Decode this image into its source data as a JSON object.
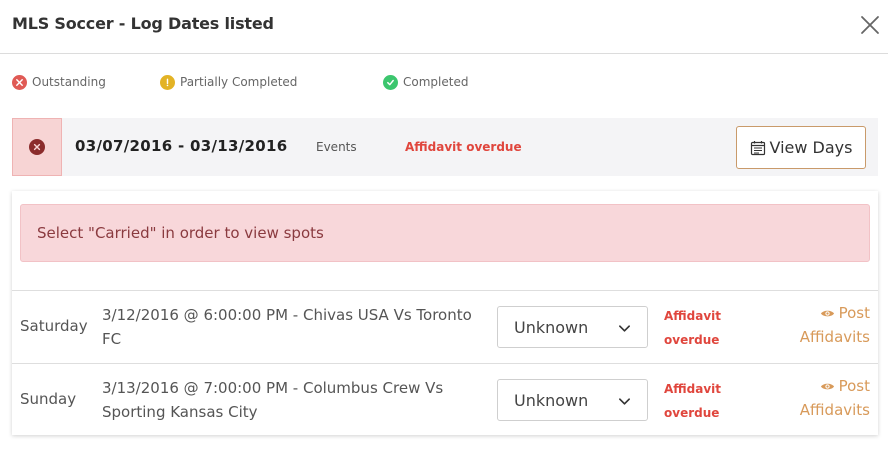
{
  "modal": {
    "title": "MLS Soccer - Log Dates listed"
  },
  "legend": {
    "outstanding": {
      "label": "Outstanding",
      "color": "#e05a55",
      "icon": "x-circle-icon"
    },
    "partial": {
      "label": "Partially Completed",
      "color": "#e3b325",
      "icon": "exclamation-circle-icon"
    },
    "completed": {
      "label": "Completed",
      "color": "#3cc66e",
      "icon": "check-circle-icon"
    }
  },
  "week": {
    "status": "outstanding",
    "range": "03/07/2016 - 03/13/2016",
    "events_label": "Events",
    "overdue_label": "Affidavit overdue",
    "view_days_label": "View Days"
  },
  "alert": {
    "message": "Select \"Carried\" in order to view spots"
  },
  "events": [
    {
      "day": "Saturday",
      "description": "3/12/2016 @ 6:00:00 PM - Chivas USA Vs Toronto FC",
      "status_select": "Unknown",
      "overdue_line1": "Affidavit",
      "overdue_line2": "overdue",
      "post_line1": "Post",
      "post_line2": "Affidavits"
    },
    {
      "day": "Sunday",
      "description": "3/13/2016 @ 7:00:00 PM - Columbus Crew Vs Sporting Kansas City",
      "status_select": "Unknown",
      "overdue_line1": "Affidavit",
      "overdue_line2": "overdue",
      "post_line1": "Post",
      "post_line2": "Affidavits"
    }
  ],
  "colors": {
    "accent": "#d89a5a",
    "overdue": "#e0463d",
    "alert_bg": "#f8d7da",
    "alert_text": "#8a3a3f"
  }
}
